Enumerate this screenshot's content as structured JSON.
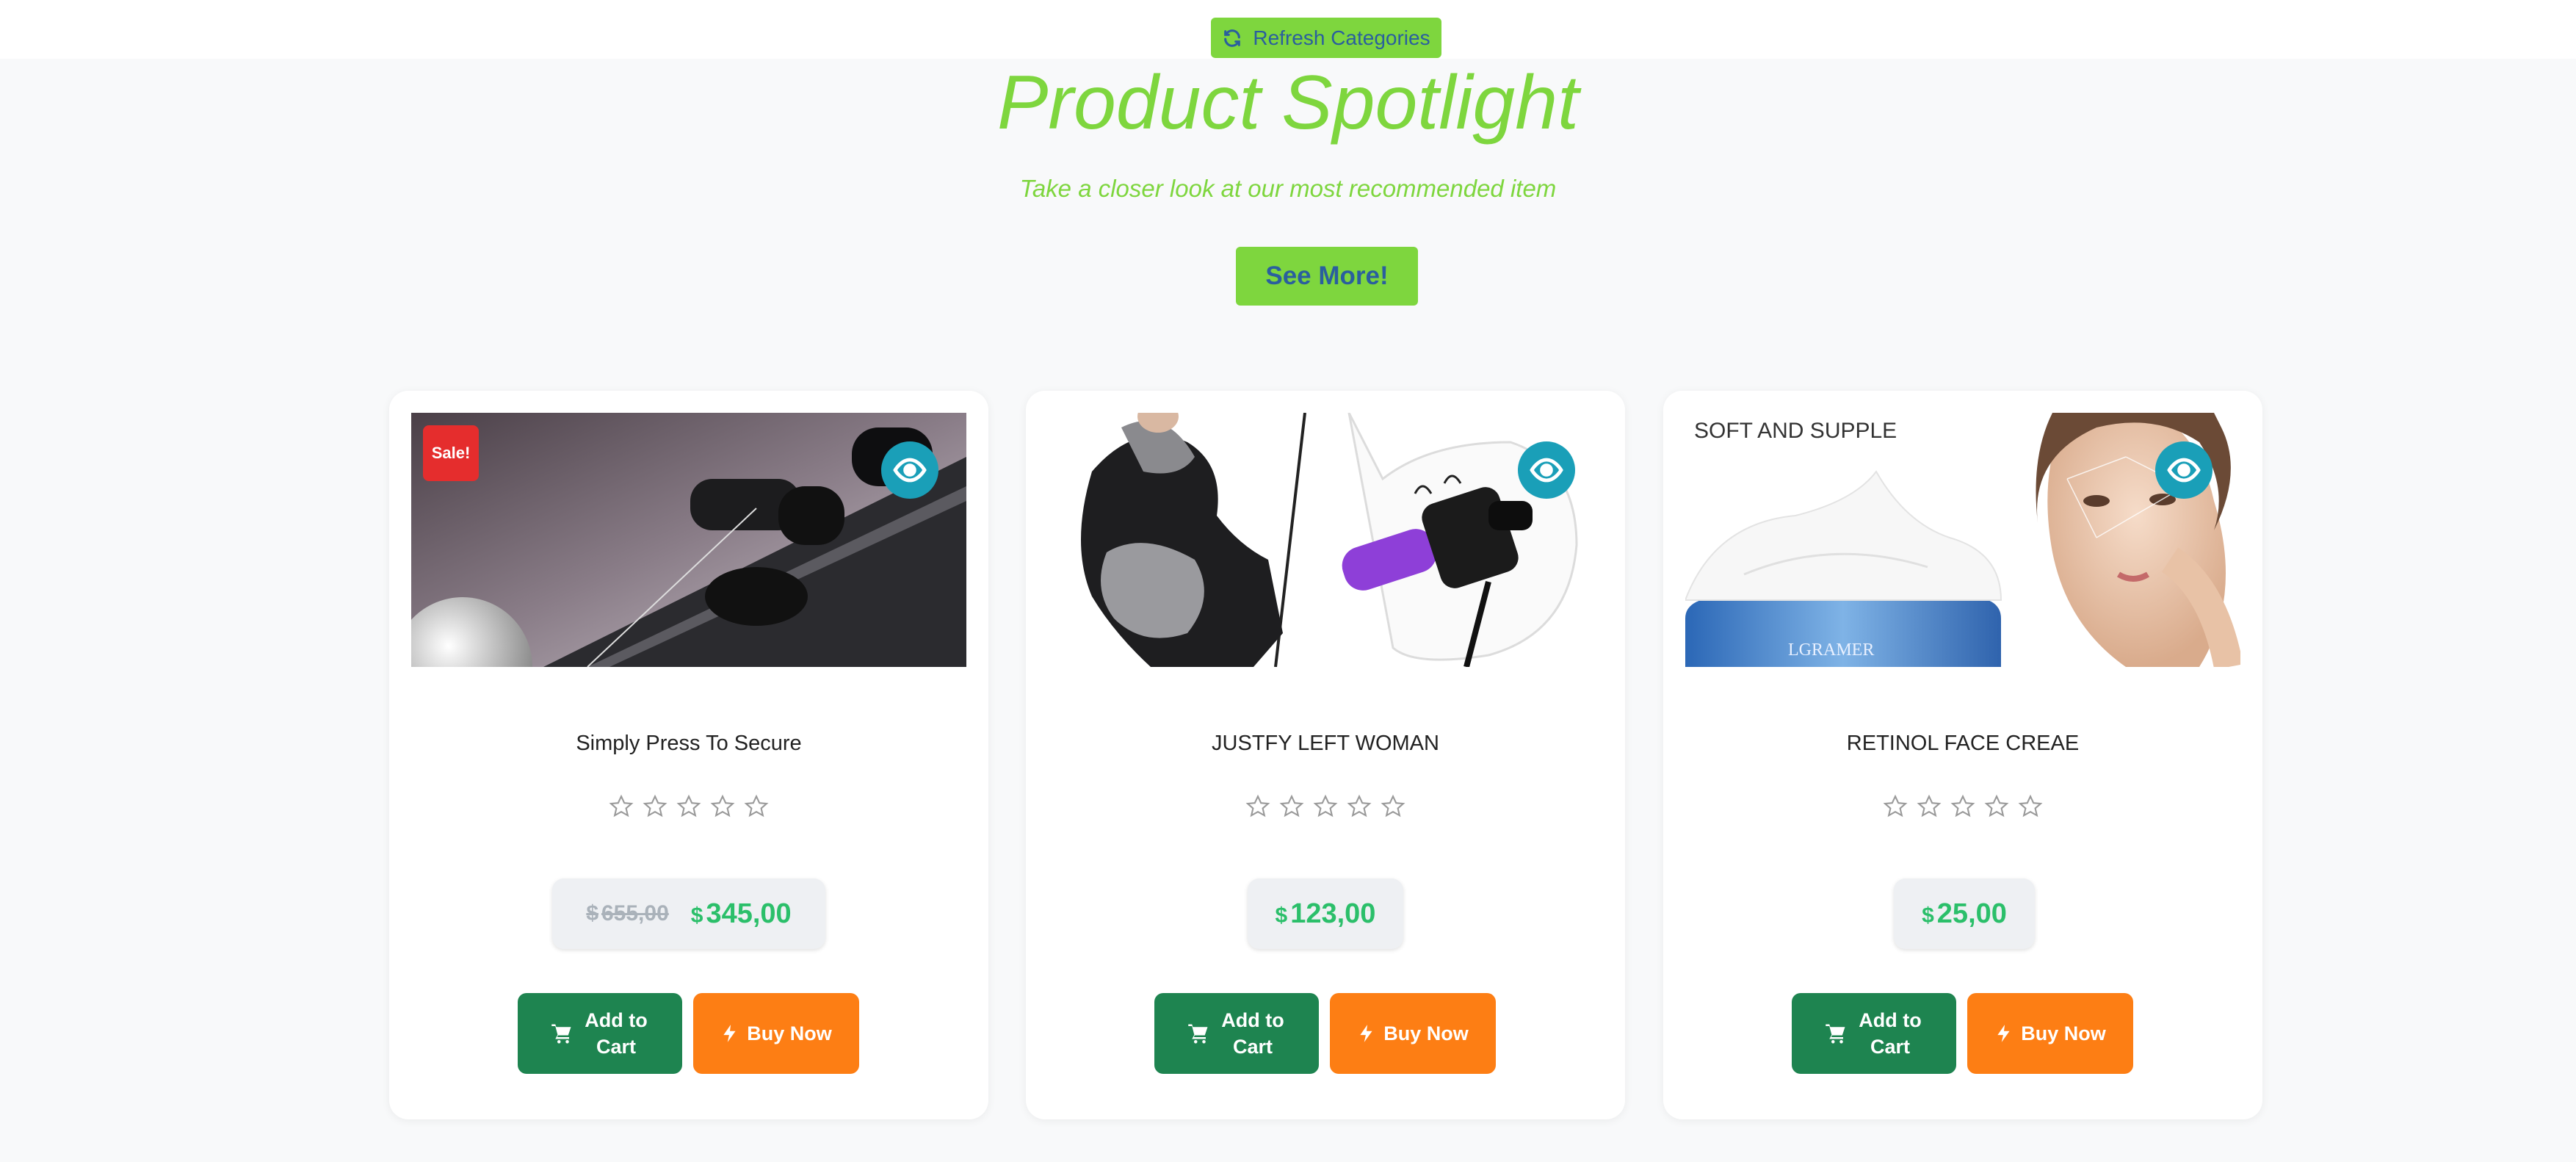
{
  "header": {
    "refresh_label": "Refresh Categories",
    "refresh_icon": "refresh-icon"
  },
  "hero": {
    "title": "Product Spotlight",
    "subtitle": "Take a closer look at our most recommended item",
    "cta_label": "See More!"
  },
  "colors": {
    "accent_green": "#7ed63e",
    "cart_green": "#1e8450",
    "buy_orange": "#fd7e14",
    "sale_red": "#e52d2d",
    "eye_teal": "#1a9fb8",
    "price_green": "#2bbf6a"
  },
  "products": [
    {
      "name": "Simply Press To Secure",
      "badge": "Sale!",
      "currency": "$",
      "old_price": "655,00",
      "price": "345,00",
      "rating": 0,
      "rating_max": 5,
      "add_to_cart_label": "Add to Cart",
      "buy_now_label": "Buy Now"
    },
    {
      "name": "JUSTFY LEFT WOMAN",
      "currency": "$",
      "price": "123,00",
      "rating": 0,
      "rating_max": 5,
      "add_to_cart_label": "Add to Cart",
      "buy_now_label": "Buy Now"
    },
    {
      "name": "RETINOL FACE CREAE",
      "image_text_top": "SOFT AND SUPPLE",
      "image_text_jar": "LGRAMER",
      "currency": "$",
      "price": "25,00",
      "rating": 0,
      "rating_max": 5,
      "add_to_cart_label": "Add to Cart",
      "buy_now_label": "Buy Now"
    }
  ]
}
